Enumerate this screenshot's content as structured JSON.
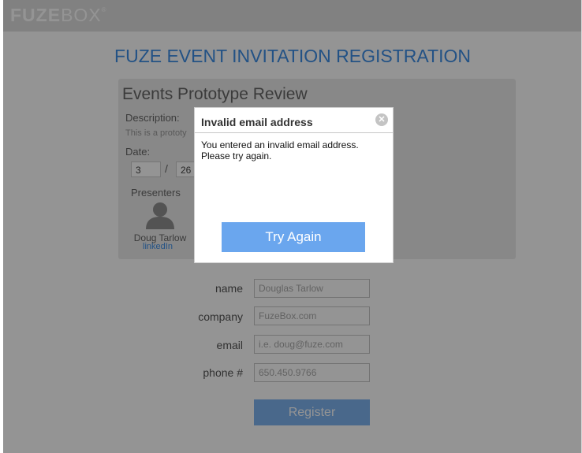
{
  "header": {
    "logo_bold": "FUZE",
    "logo_light": "BOX",
    "logo_tm": "®"
  },
  "page": {
    "title": "FUZE EVENT INVITATION REGISTRATION"
  },
  "event": {
    "title": "Events Prototype Review",
    "description_label": "Description:",
    "description_text": "This is a prototy",
    "date_label": "Date:",
    "date_month": "3",
    "date_separator": "/",
    "date_day": "26",
    "presenters_label": "Presenters",
    "presenter": {
      "name": "Doug Tarlow",
      "link_label": "linkedIn",
      "icon": "person-silhouette-icon"
    }
  },
  "form": {
    "fields": [
      {
        "label": "name",
        "placeholder": "Douglas Tarlow"
      },
      {
        "label": "company",
        "placeholder": "FuzeBox.com"
      },
      {
        "label": "email",
        "placeholder": "i.e. doug@fuze.com"
      },
      {
        "label": "phone #",
        "placeholder": "650.450.9766"
      }
    ],
    "submit_label": "Register"
  },
  "modal": {
    "title": "Invalid email address",
    "close_icon": "close-circle-icon",
    "message_line1": "You entered an invalid email address.",
    "message_line2": "Please try again.",
    "button_label": "Try Again"
  },
  "colors": {
    "accent": "#3d8ee6",
    "button": "#6aa6ee",
    "overlay": "#000000"
  }
}
